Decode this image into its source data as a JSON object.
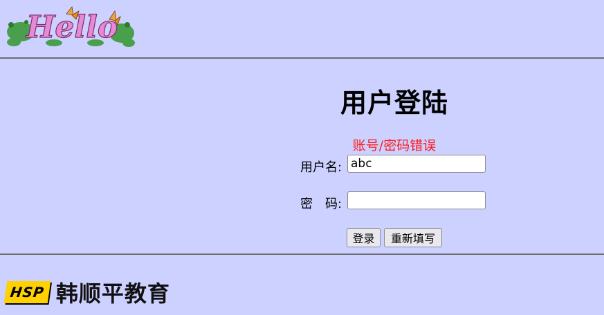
{
  "header": {
    "logo_text": "Hello"
  },
  "login": {
    "title": "用户登陆",
    "error_message": "账号/密码错误",
    "username_label": "用户名:",
    "username_value": "abc",
    "password_label": "密　码:",
    "password_value": "",
    "submit_label": "登录",
    "reset_label": "重新填写"
  },
  "footer": {
    "badge_text": "HSP",
    "brand_name": "韩顺平教育"
  },
  "colors": {
    "background": "#cdd1ff",
    "error": "#ff1a1a",
    "badge": "#ffd100"
  }
}
